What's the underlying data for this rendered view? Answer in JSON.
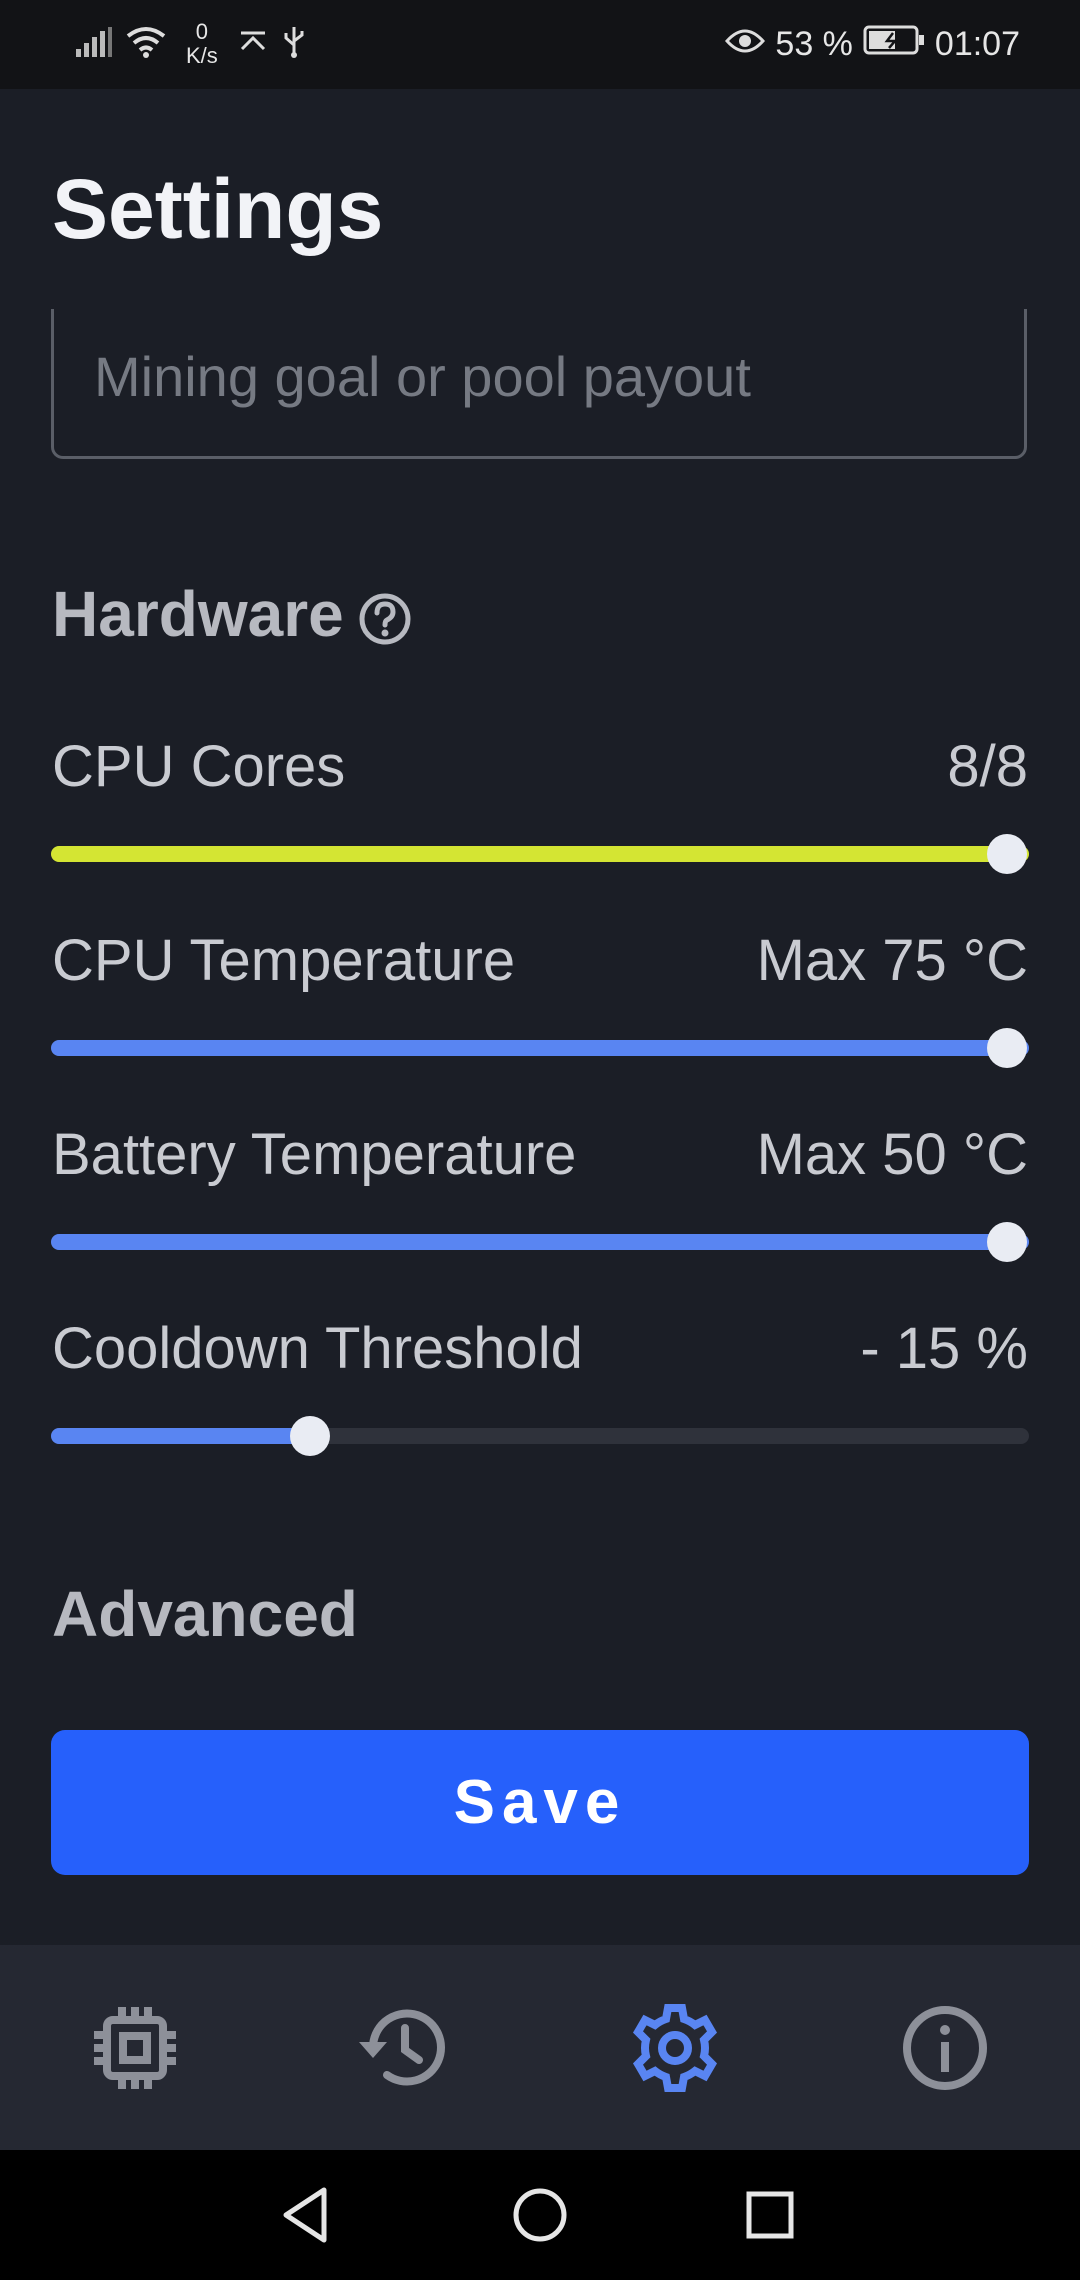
{
  "status_bar": {
    "net_speed_value": "0",
    "net_speed_unit": "K/s",
    "battery_percent": "53 %",
    "time": "01:07"
  },
  "header": {
    "title": "Settings"
  },
  "wallet_field": {
    "placeholder": "Mining goal or pool payout",
    "value": ""
  },
  "hardware": {
    "title": "Hardware",
    "rows": [
      {
        "label": "CPU Cores",
        "value_text": "8/8",
        "level": 1.0,
        "fill_color": "#d4e533"
      },
      {
        "label": "CPU Temperature",
        "value_text": "Max 75 °C",
        "level": 1.0,
        "fill_color": "#5985f2"
      },
      {
        "label": "Battery Temperature",
        "value_text": "Max 50 °C",
        "level": 1.0,
        "fill_color": "#5985f2"
      },
      {
        "label": "Cooldown Threshold",
        "value_text": "- 15 %",
        "level": 0.265,
        "fill_color": "#5985f2"
      }
    ]
  },
  "advanced": {
    "title": "Advanced"
  },
  "save_button": {
    "label": "Save",
    "color": "#2660fb"
  },
  "bottom_nav": {
    "items": [
      {
        "icon": "cpu-chip-icon",
        "active": false
      },
      {
        "icon": "history-icon",
        "active": false
      },
      {
        "icon": "gear-icon",
        "active": true
      },
      {
        "icon": "info-icon",
        "active": false
      }
    ],
    "active_color": "#5985f2",
    "inactive_color": "#8d9099"
  },
  "system_nav": {
    "icons": [
      "back-icon",
      "home-icon",
      "recents-icon"
    ]
  }
}
